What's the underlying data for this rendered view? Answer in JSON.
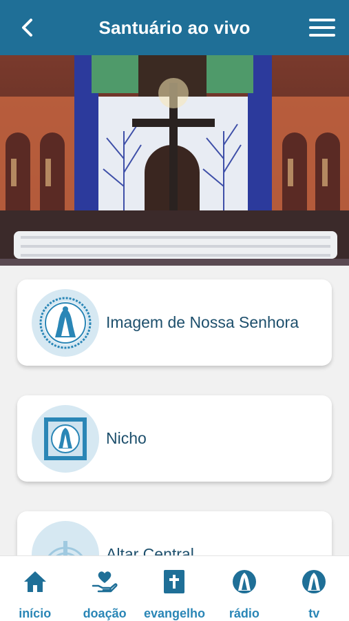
{
  "header": {
    "title": "Santuário ao vivo"
  },
  "cards": [
    {
      "label": "Imagem de Nossa Senhora"
    },
    {
      "label": "Nicho"
    },
    {
      "label": "Altar Central"
    }
  ],
  "tabbar": {
    "items": [
      {
        "label": "início",
        "icon": "home-icon"
      },
      {
        "label": "doação",
        "icon": "heart-hand-icon"
      },
      {
        "label": "evangelho",
        "icon": "bible-icon"
      },
      {
        "label": "rádio",
        "icon": "our-lady-icon"
      },
      {
        "label": "tv",
        "icon": "our-lady-icon"
      }
    ]
  },
  "colors": {
    "header": "#1f6f97",
    "accent": "#2a86b6",
    "card_text": "#1d4f6c",
    "icon_bg": "#d6e8f2"
  }
}
